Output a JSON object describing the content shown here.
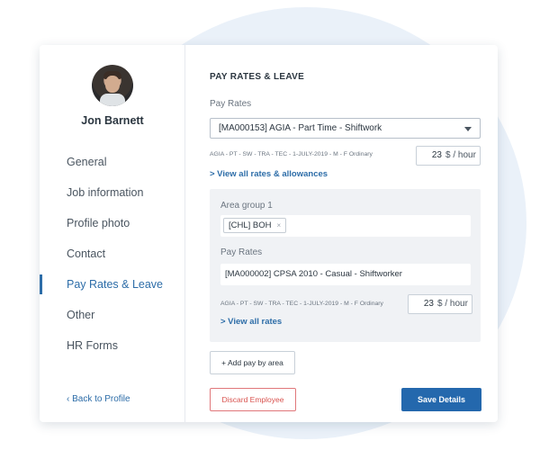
{
  "profile": {
    "name": "Jon Barnett"
  },
  "nav": {
    "items": [
      {
        "label": "General"
      },
      {
        "label": "Job information"
      },
      {
        "label": "Profile photo"
      },
      {
        "label": "Contact"
      },
      {
        "label": "Pay Rates & Leave",
        "active": true
      },
      {
        "label": "Other"
      },
      {
        "label": "HR Forms"
      }
    ],
    "back_label": "‹ Back to Profile"
  },
  "main": {
    "title": "PAY RATES & LEAVE",
    "pay_rates_label": "Pay Rates",
    "pay_rate_select_value": "[MA000153] AGIA - Part Time - Shiftwork",
    "pay_rate_meta": "AGIA - PT - SW - TRA - TEC - 1-JULY-2019 - M - F Ordinary",
    "rate_value": "23",
    "rate_unit": "$ / hour",
    "view_all_link": "> View all rates & allowances",
    "area": {
      "group_label": "Area group 1",
      "tag": "[CHL] BOH",
      "tag_remove": "×",
      "pay_rates_label": "Pay Rates",
      "pay_rate_value": "[MA000002]  CPSA 2010 - Casual - Shiftworker",
      "meta": "AGIA - PT - SW - TRA - TEC - 1-JULY-2019 - M - F Ordinary",
      "rate_value": "23",
      "rate_unit": "$ / hour",
      "view_all_link": "> View all rates"
    },
    "add_pay_button": "+ Add pay by area",
    "discard_button": "Discard Employee",
    "save_button": "Save Details"
  },
  "colors": {
    "accent": "#2d6da8",
    "save_button": "#2468ad",
    "danger": "#d9534f",
    "background_blob": "#eaf1f9"
  }
}
